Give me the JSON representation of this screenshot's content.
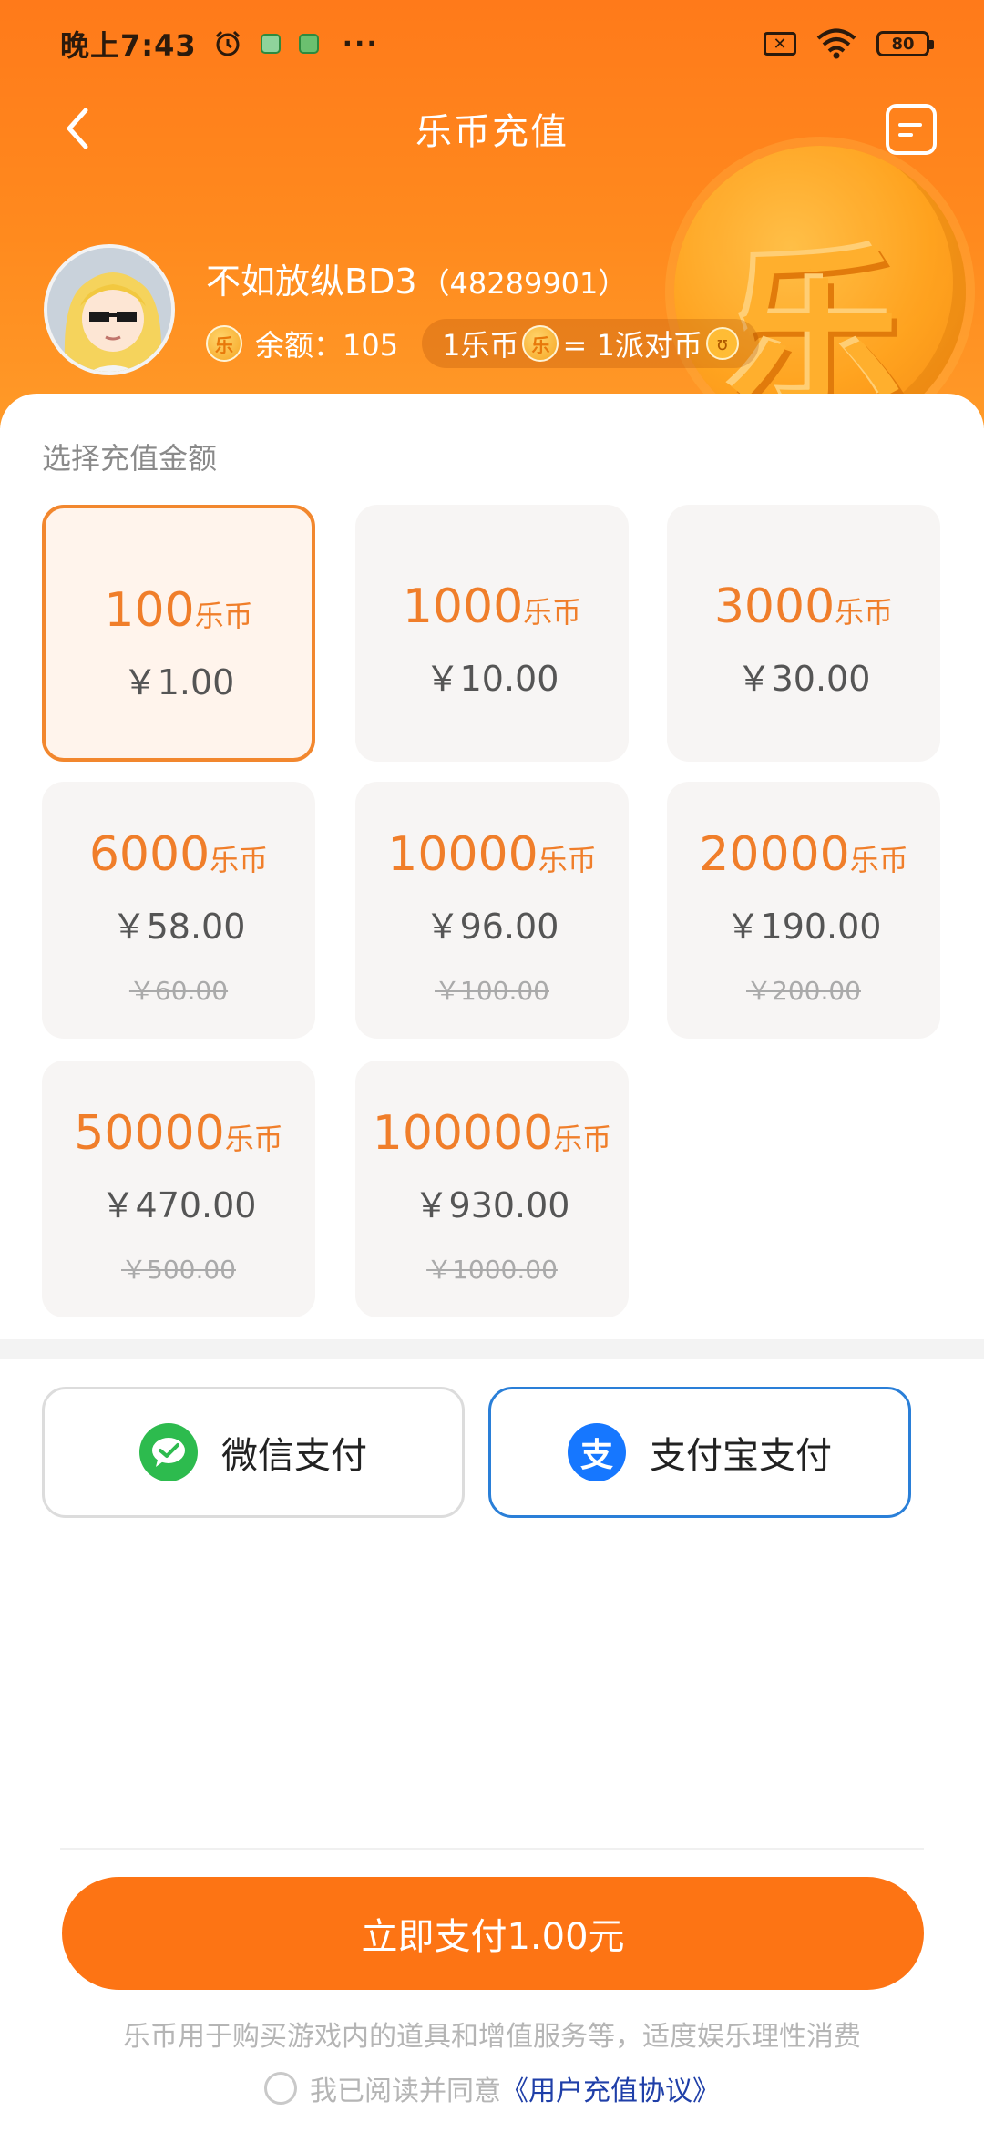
{
  "status_bar": {
    "time": "晚上7:43",
    "more": "···",
    "sim_mark": "✕",
    "battery": "80"
  },
  "nav": {
    "title": "乐币充值"
  },
  "decor": {
    "coin_glyph": "乐"
  },
  "user": {
    "name": "不如放纵BD3",
    "id": "（48289901）",
    "balance_label": "余额：105",
    "coin_glyph": "乐",
    "rate_left": "1乐币",
    "rate_right": "= 1派对币",
    "party_glyph": "ʊ"
  },
  "amount_section": {
    "label": "选择充值金额",
    "unit": "乐币",
    "options": [
      {
        "coins": "100",
        "price": "￥1.00",
        "original": ""
      },
      {
        "coins": "1000",
        "price": "￥10.00",
        "original": ""
      },
      {
        "coins": "3000",
        "price": "￥30.00",
        "original": ""
      },
      {
        "coins": "6000",
        "price": "￥58.00",
        "original": "￥60.00"
      },
      {
        "coins": "10000",
        "price": "￥96.00",
        "original": "￥100.00"
      },
      {
        "coins": "20000",
        "price": "￥190.00",
        "original": "￥200.00"
      },
      {
        "coins": "50000",
        "price": "￥470.00",
        "original": "￥500.00"
      },
      {
        "coins": "100000",
        "price": "￥930.00",
        "original": "￥1000.00"
      }
    ],
    "selected_index": 0
  },
  "payment": {
    "wechat_label": "微信支付",
    "alipay_label": "支付宝支付",
    "alipay_glyph": "支",
    "selected": "alipay"
  },
  "footer": {
    "pay_button": "立即支付1.00元",
    "notice": "乐币用于购买游戏内的道具和增值服务等，适度娱乐理性消费",
    "agree_text": "我已阅读并同意",
    "agreement_link": "《用户充值协议》"
  },
  "colors": {
    "header": "#ff7a1a",
    "accent": "#f07e2a",
    "pay_button": "#fd7414",
    "alipay_border": "#2a7fd8",
    "wechat_green": "#2dbb4e"
  }
}
